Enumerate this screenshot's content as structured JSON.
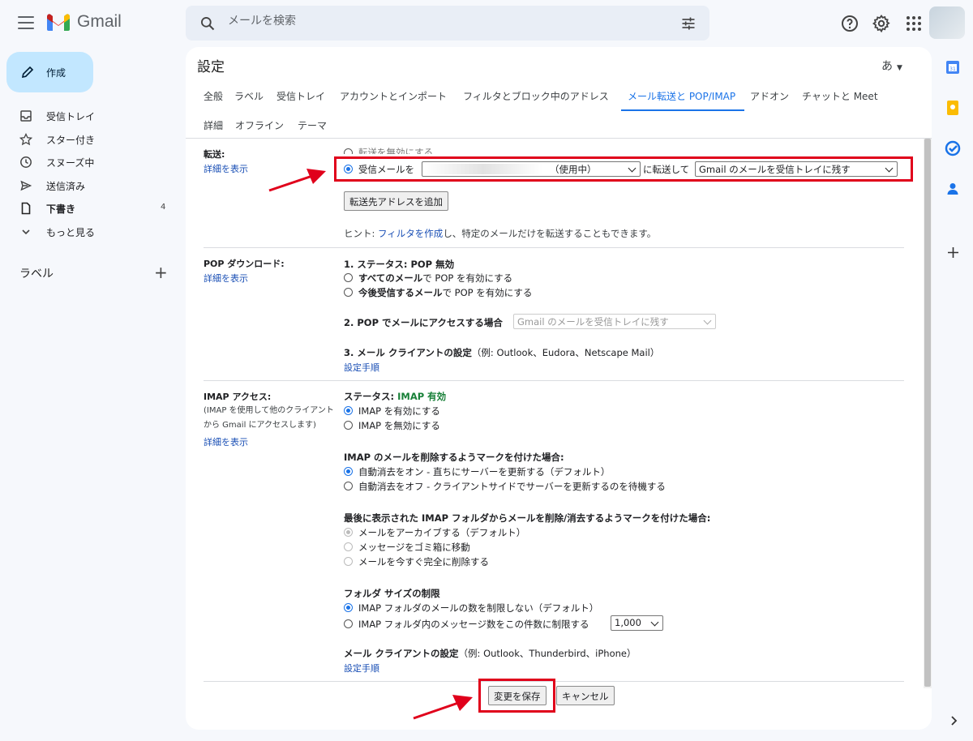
{
  "app": {
    "name": "Gmail"
  },
  "search": {
    "placeholder": "メールを検索"
  },
  "sidebar": {
    "compose_label": "作成",
    "items": [
      {
        "label": "受信トレイ",
        "icon": "inbox-icon"
      },
      {
        "label": "スター付き",
        "icon": "star-icon"
      },
      {
        "label": "スヌーズ中",
        "icon": "clock-icon"
      },
      {
        "label": "送信済み",
        "icon": "send-icon"
      },
      {
        "label": "下書き",
        "icon": "draft-icon",
        "count": "4"
      },
      {
        "label": "もっと見る",
        "icon": "chevron-down-icon"
      }
    ],
    "labels_heading": "ラベル",
    "labels_add": "+"
  },
  "settings": {
    "title": "設定",
    "input_lang": "あ",
    "tabs": [
      "全般",
      "ラベル",
      "受信トレイ",
      "アカウントとインポート",
      "フィルタとブロック中のアドレス",
      "メール転送と POP/IMAP",
      "アドオン",
      "チャットと Meet",
      "詳細",
      "オフライン",
      "テーマ"
    ],
    "active_tab": "メール転送と POP/IMAP",
    "forwarding": {
      "label": "転送:",
      "learn_more": "詳細を表示",
      "option_disable": "転送を無効にする",
      "option_forward_prefix": "受信メールを",
      "address_suffix": "（使用中）",
      "forward_middle": "に転送して",
      "action_select": "Gmail のメールを受信トレイに残す",
      "add_address_button": "転送先アドレスを追加",
      "hint_prefix": "ヒント: ",
      "hint_link": "フィルタを作成",
      "hint_suffix": "し、特定のメールだけを転送することもできます。"
    },
    "pop": {
      "label": "POP ダウンロード:",
      "learn_more": "詳細を表示",
      "status": "1. ステータス: POP 無効",
      "opt_all_bold": "すべてのメール",
      "opt_all_rest": "で POP を有効にする",
      "opt_new_bold": "今後受信するメール",
      "opt_new_rest": "で POP を有効にする",
      "access_label": "2. POP でメールにアクセスする場合",
      "access_select": "Gmail のメールを受信トレイに残す",
      "client_bold": "3. メール クライアントの設定",
      "client_rest": "（例: Outlook、Eudora、Netscape Mail）",
      "setup_link": "設定手順"
    },
    "imap": {
      "label": "IMAP アクセス:",
      "sub1": "(IMAP を使用して他のクライアント",
      "sub2": "から Gmail にアクセスします)",
      "learn_more": "詳細を表示",
      "status_prefix": "ステータス: ",
      "status_value": "IMAP 有効",
      "opt_enable": "IMAP を有効にする",
      "opt_disable": "IMAP を無効にする",
      "delete_heading": "IMAP のメールを削除するようマークを付けた場合:",
      "delete_opt1": "自動消去をオン - 直ちにサーバーを更新する（デフォルト）",
      "delete_opt2": "自動消去をオフ - クライアントサイドでサーバーを更新するのを待機する",
      "expunge_heading": "最後に表示された IMAP フォルダからメールを削除/消去するようマークを付けた場合:",
      "expunge_opt1": "メールをアーカイブする（デフォルト）",
      "expunge_opt2": "メッセージをゴミ箱に移動",
      "expunge_opt3": "メールを今すぐ完全に削除する",
      "folder_heading": "フォルダ サイズの制限",
      "folder_opt1": "IMAP フォルダのメールの数を制限しない（デフォルト）",
      "folder_opt2": "IMAP フォルダ内のメッセージ数をこの件数に制限する",
      "folder_limit": "1,000",
      "client_bold": "メール クライアントの設定",
      "client_rest": "（例: Outlook、Thunderbird、iPhone）",
      "setup_link": "設定手順"
    },
    "save_button": "変更を保存",
    "cancel_button": "キャンセル"
  },
  "colors": {
    "accent": "#1a73e8",
    "annotation_red": "#e0001b",
    "compose_bg": "#c2e7ff",
    "status_green": "#188038"
  }
}
